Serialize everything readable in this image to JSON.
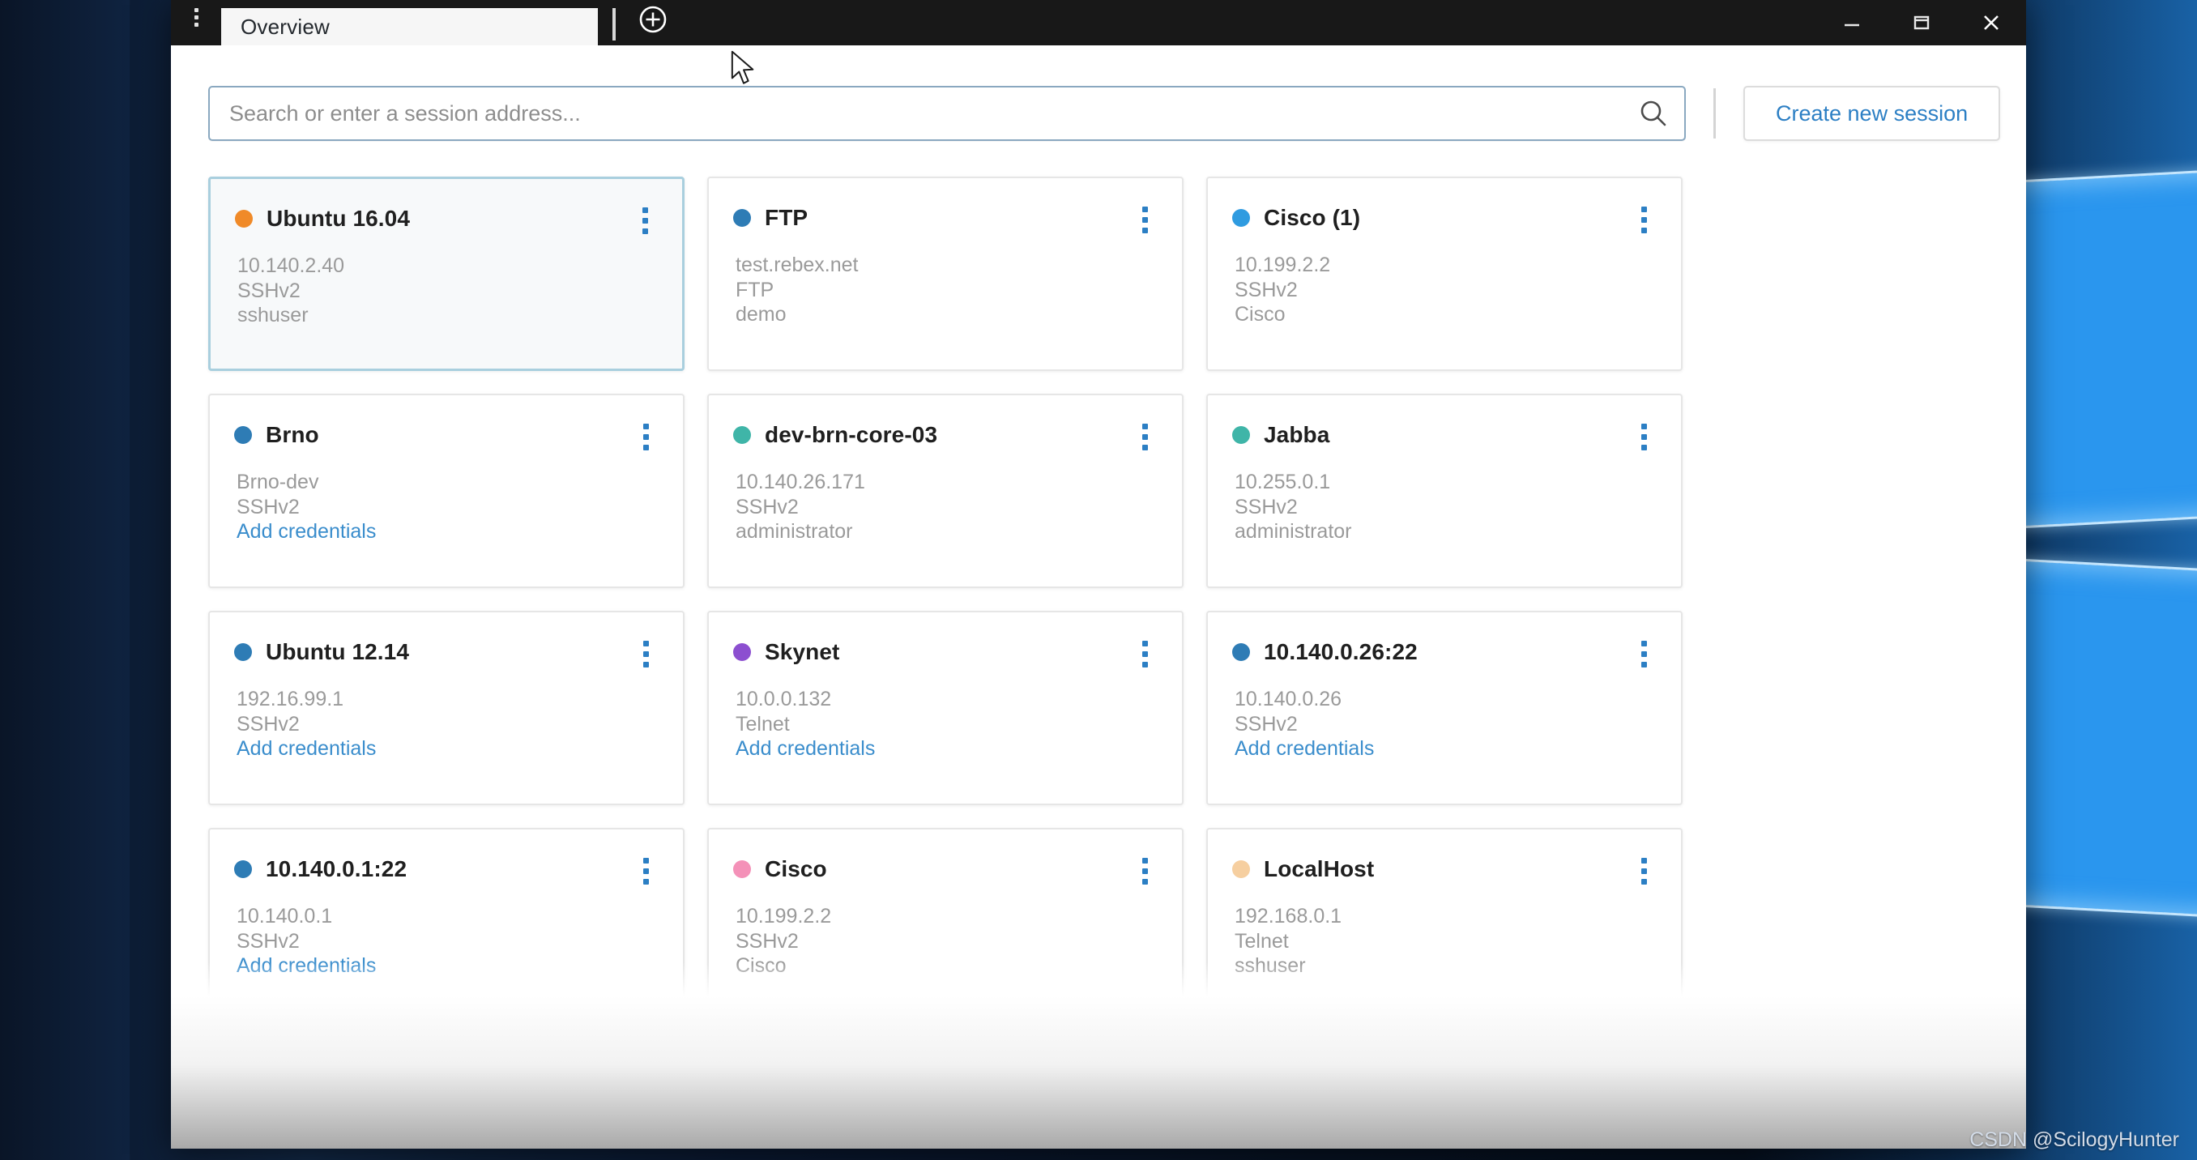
{
  "window": {
    "menu_icon": "kebab-menu-icon",
    "new_tab_icon": "plus-circle-icon",
    "minimize_label": "Minimize",
    "maximize_label": "Maximize",
    "close_label": "Close",
    "tabs": [
      {
        "label": "Overview",
        "active": true
      }
    ]
  },
  "toolbar": {
    "search": {
      "placeholder": "Search or enter a session address...",
      "value": "",
      "icon": "search-icon"
    },
    "create_session_label": "Create new session"
  },
  "colors": {
    "accent": "#30c1e8",
    "link": "#3a8dcc",
    "tab_underline": "#30c1e8",
    "titlebar": "#181818",
    "selected_card_border": "#a9cfde",
    "dot_orange": "#f08a28",
    "dot_steel_blue": "#2e7cb5",
    "dot_bright_blue": "#2f9be0",
    "dot_teal": "#3fb5a8",
    "dot_purple": "#8c4fd0",
    "dot_pink": "#f491b8",
    "dot_peach": "#f6cfa0"
  },
  "sessions": [
    {
      "name": "Ubuntu 16.04",
      "dot_color": "#f08a28",
      "host": "10.140.2.40",
      "protocol": "SSHv2",
      "credential": "sshuser",
      "credential_is_link": false,
      "selected": true
    },
    {
      "name": "FTP",
      "dot_color": "#2e7cb5",
      "host": "test.rebex.net",
      "protocol": "FTP",
      "credential": "demo",
      "credential_is_link": false,
      "selected": false
    },
    {
      "name": "Cisco (1)",
      "dot_color": "#2f9be0",
      "host": "10.199.2.2",
      "protocol": "SSHv2",
      "credential": "Cisco",
      "credential_is_link": false,
      "selected": false
    },
    {
      "name": "Brno",
      "dot_color": "#2e7cb5",
      "host": "Brno-dev",
      "protocol": "SSHv2",
      "credential": "Add credentials",
      "credential_is_link": true,
      "selected": false
    },
    {
      "name": "dev-brn-core-03",
      "dot_color": "#3fb5a8",
      "host": "10.140.26.171",
      "protocol": "SSHv2",
      "credential": "administrator",
      "credential_is_link": false,
      "selected": false
    },
    {
      "name": "Jabba",
      "dot_color": "#3fb5a8",
      "host": "10.255.0.1",
      "protocol": "SSHv2",
      "credential": "administrator",
      "credential_is_link": false,
      "selected": false
    },
    {
      "name": "Ubuntu 12.14",
      "dot_color": "#2e7cb5",
      "host": "192.16.99.1",
      "protocol": "SSHv2",
      "credential": "Add credentials",
      "credential_is_link": true,
      "selected": false
    },
    {
      "name": "Skynet",
      "dot_color": "#8c4fd0",
      "host": "10.0.0.132",
      "protocol": "Telnet",
      "credential": "Add credentials",
      "credential_is_link": true,
      "selected": false
    },
    {
      "name": "10.140.0.26:22",
      "dot_color": "#2e7cb5",
      "host": "10.140.0.26",
      "protocol": "SSHv2",
      "credential": "Add credentials",
      "credential_is_link": true,
      "selected": false
    },
    {
      "name": "10.140.0.1:22",
      "dot_color": "#2e7cb5",
      "host": "10.140.0.1",
      "protocol": "SSHv2",
      "credential": "Add credentials",
      "credential_is_link": true,
      "selected": false
    },
    {
      "name": "Cisco",
      "dot_color": "#f491b8",
      "host": "10.199.2.2",
      "protocol": "SSHv2",
      "credential": "Cisco",
      "credential_is_link": false,
      "selected": false
    },
    {
      "name": "LocalHost",
      "dot_color": "#f6cfa0",
      "host": "192.168.0.1",
      "protocol": "Telnet",
      "credential": "sshuser",
      "credential_is_link": false,
      "selected": false
    }
  ],
  "watermark": "CSDN @ScilogyHunter"
}
